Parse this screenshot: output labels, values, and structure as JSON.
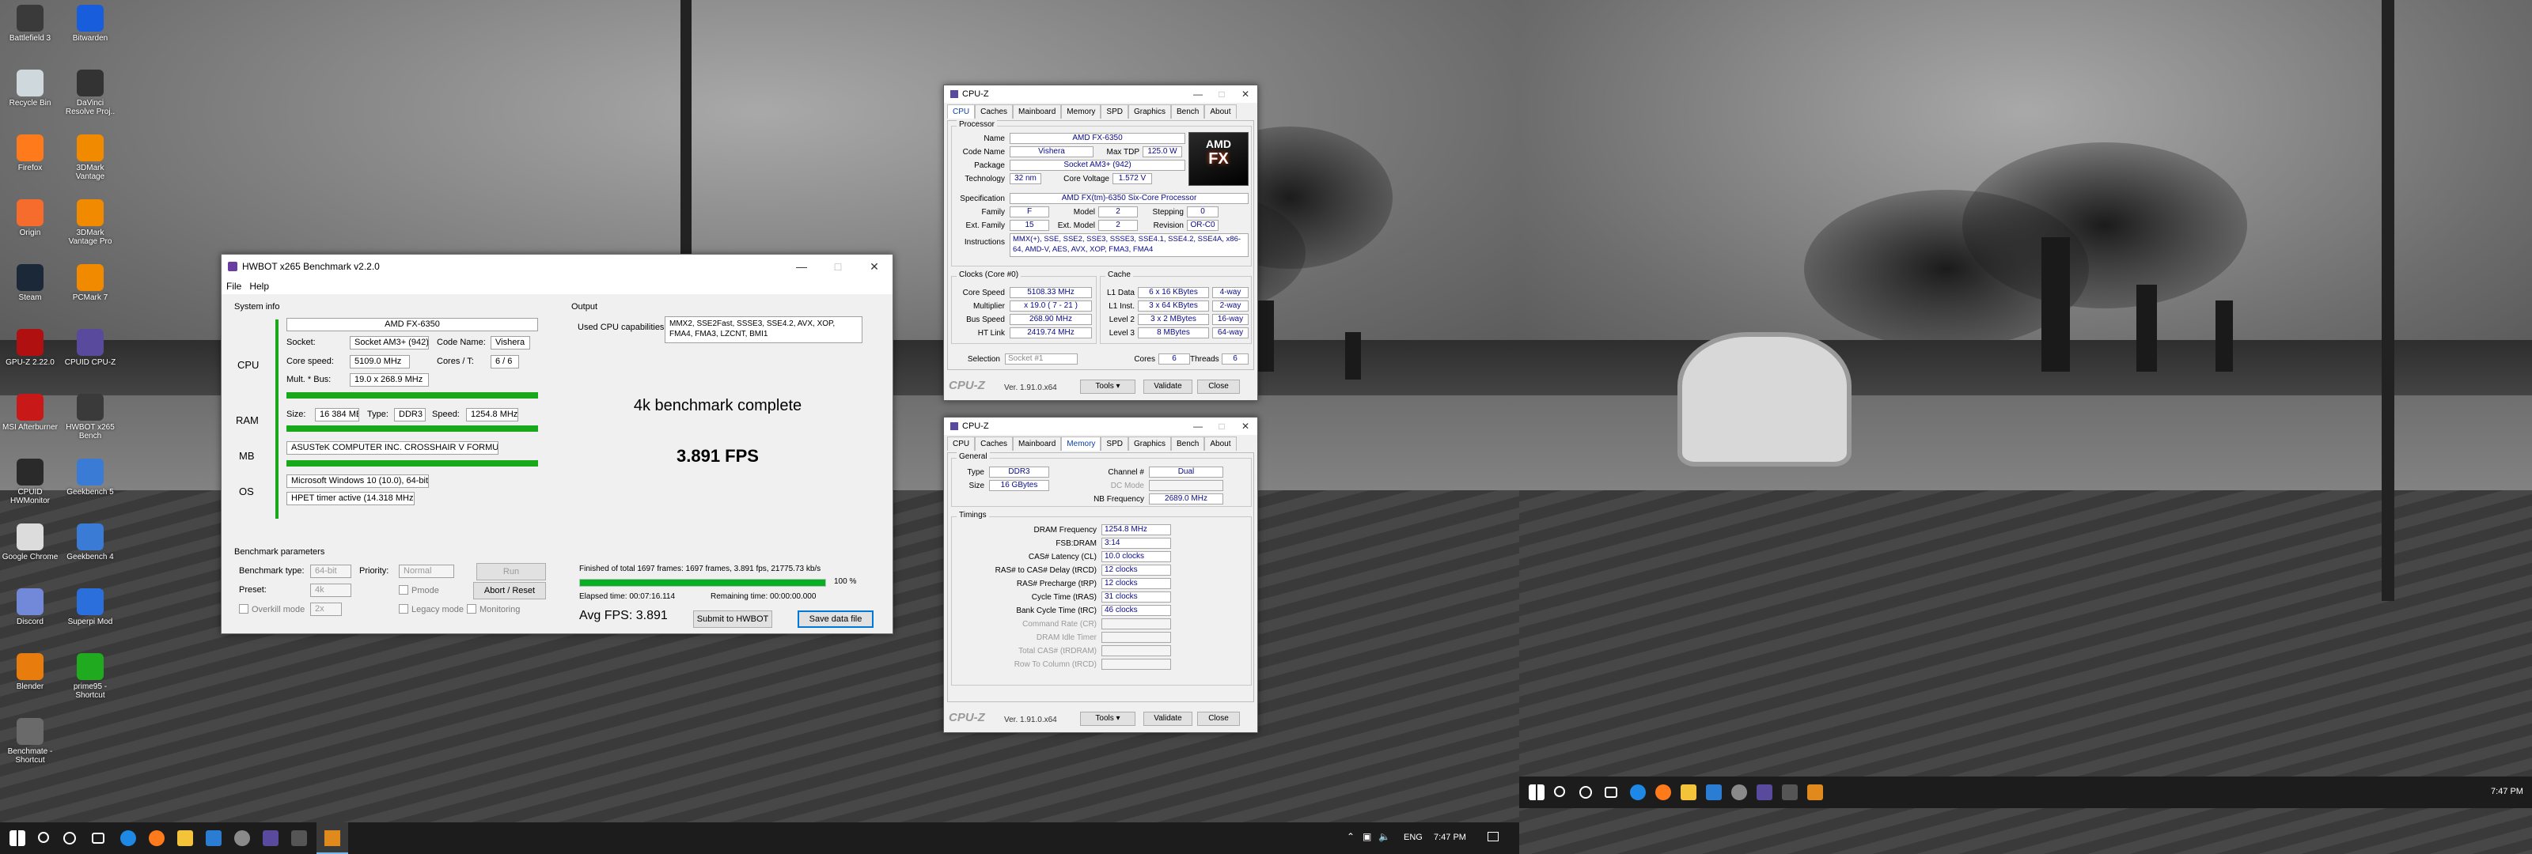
{
  "desktop_icons": [
    {
      "label": "Battlefield 3",
      "color": "#3a3a3a"
    },
    {
      "label": "Recycle Bin",
      "color": "#cfd8dc"
    },
    {
      "label": "Firefox",
      "color": "#ff7a1a"
    },
    {
      "label": "Origin",
      "color": "#f56c2d"
    },
    {
      "label": "Steam",
      "color": "#1b2838"
    },
    {
      "label": "GPU-Z 2.22.0",
      "color": "#b01010"
    },
    {
      "label": "MSI Afterburner",
      "color": "#c81818"
    },
    {
      "label": "CPUID HWMonitor",
      "color": "#2a2a2a"
    },
    {
      "label": "Google Chrome",
      "color": "#dcdcdc"
    },
    {
      "label": "Discord",
      "color": "#7289da"
    },
    {
      "label": "Blender",
      "color": "#e87d0d"
    },
    {
      "label": "Benchmate - Shortcut",
      "color": "#6a6a6a"
    }
  ],
  "desktop_icons_col2": [
    {
      "label": "Bitwarden",
      "color": "#175ddc"
    },
    {
      "label": "DaVinci Resolve Proj..",
      "color": "#333333"
    },
    {
      "label": "3DMark Vantage",
      "color": "#f28a00"
    },
    {
      "label": "3DMark Vantage Pro",
      "color": "#f28a00"
    },
    {
      "label": "PCMark 7",
      "color": "#f28a00"
    },
    {
      "label": "CPUID CPU-Z",
      "color": "#5a4a9e"
    },
    {
      "label": "HWBOT x265 Bench",
      "color": "#3a3a3a"
    },
    {
      "label": "Geekbench 5",
      "color": "#3a7bd5"
    },
    {
      "label": "Geekbench 4",
      "color": "#3a7bd5"
    },
    {
      "label": "Superpi Mod",
      "color": "#2a6fdb"
    },
    {
      "label": "prime95 - Shortcut",
      "color": "#1faa1f"
    }
  ],
  "x265": {
    "title": "HWBOT x265 Benchmark v2.2.0",
    "menu": [
      "File",
      "Help"
    ],
    "system_info_title": "System info",
    "cpu_name": "AMD FX-6350",
    "socket_label": "Socket:",
    "socket": "Socket AM3+ (942)",
    "codename_label": "Code Name:",
    "codename": "Vishera",
    "core_speed_label": "Core speed:",
    "core_speed": "5109.0 MHz",
    "cores_label": "Cores / T:",
    "cores": "6 / 6",
    "mult_label": "Mult. * Bus:",
    "mult": "19.0 x 268.9 MHz",
    "cpu_side": "CPU",
    "ram_side": "RAM",
    "mb_side": "MB",
    "os_side": "OS",
    "size_label": "Size:",
    "size": "16 384 MB",
    "type_label": "Type:",
    "type": "DDR3",
    "speed_label": "Speed:",
    "speed": "1254.8 MHz",
    "mb": "ASUSTeK COMPUTER INC. CROSSHAIR V FORMULA-Z",
    "os": "Microsoft Windows 10 (10.0), 64-bit",
    "timer": "HPET timer active (14.318 MHz )",
    "output_title": "Output",
    "used_caps_label": "Used CPU capabilities:",
    "used_caps": "MMX2, SSE2Fast, SSSE3, SSE4.2, AVX, XOP, FMA4, FMA3, LZCNT, BMI1",
    "complete": "4k benchmark complete",
    "fps": "3.891 FPS",
    "finished": "Finished of total 1697 frames: 1697 frames, 3.891 fps,  21775.73 kb/s",
    "progress": 1.0,
    "progress_text": "100 %",
    "elapsed": "Elapsed time: 00:07:16.114",
    "remaining": "Remaining time: 00:00:00.000",
    "avg": "Avg FPS: 3.891",
    "submit": "Submit to HWBOT",
    "save": "Save data file",
    "params_title": "Benchmark parameters",
    "bench_type_label": "Benchmark type:",
    "bench_type": "64-bit",
    "priority_label": "Priority:",
    "priority": "Normal",
    "run": "Run",
    "preset_label": "Preset:",
    "preset": "4k",
    "pmode": "Pmode",
    "abort": "Abort / Reset",
    "overkill": "Overkill mode",
    "overkill_val": "2x",
    "legacy": "Legacy mode",
    "monitoring": "Monitoring"
  },
  "cpuz1": {
    "title": "CPU-Z",
    "tabs": [
      "CPU",
      "Caches",
      "Mainboard",
      "Memory",
      "SPD",
      "Graphics",
      "Bench",
      "About"
    ],
    "proc_title": "Processor",
    "name_l": "Name",
    "name": "AMD FX-6350",
    "code_l": "Code Name",
    "code": "Vishera",
    "tdp_l": "Max TDP",
    "tdp": "125.0 W",
    "pkg_l": "Package",
    "pkg": "Socket AM3+ (942)",
    "tech_l": "Technology",
    "tech": "32 nm",
    "cv_l": "Core Voltage",
    "cv": "1.572 V",
    "spec_l": "Specification",
    "spec": "AMD FX(tm)-6350 Six-Core Processor",
    "fam_l": "Family",
    "fam": "F",
    "model_l": "Model",
    "model": "2",
    "step_l": "Stepping",
    "step": "0",
    "efam_l": "Ext. Family",
    "efam": "15",
    "emodel_l": "Ext. Model",
    "emodel": "2",
    "rev_l": "Revision",
    "rev": "OR-C0",
    "inst_l": "Instructions",
    "inst": "MMX(+), SSE, SSE2, SSE3, SSSE3, SSE4.1, SSE4.2, SSE4A, x86-64, AMD-V, AES, AVX, XOP, FMA3, FMA4",
    "clocks_title": "Clocks (Core #0)",
    "cs_l": "Core Speed",
    "cs": "5108.33 MHz",
    "mul_l": "Multiplier",
    "mul": "x 19.0 ( 7 - 21 )",
    "bus_l": "Bus Speed",
    "bus": "268.90 MHz",
    "ht_l": "HT Link",
    "ht": "2419.74 MHz",
    "cache_title": "Cache",
    "l1d_l": "L1 Data",
    "l1d": "6 x 16 KBytes",
    "l1d_w": "4-way",
    "l1i_l": "L1 Inst.",
    "l1i": "3 x 64 KBytes",
    "l1i_w": "2-way",
    "l2_l": "Level 2",
    "l2": "3 x 2 MBytes",
    "l2_w": "16-way",
    "l3_l": "Level 3",
    "l3": "8 MBytes",
    "l3_w": "64-way",
    "sel_l": "Selection",
    "sel": "Socket #1",
    "cores_l": "Cores",
    "cores": "6",
    "threads_l": "Threads",
    "threads": "6",
    "logo": "CPU-Z",
    "ver": "Ver. 1.91.0.x64",
    "tools": "Tools",
    "validate": "Validate",
    "close": "Close",
    "amd_logo": "AMD",
    "fx_logo": "FX"
  },
  "cpuz2": {
    "title": "CPU-Z",
    "tabs": [
      "CPU",
      "Caches",
      "Mainboard",
      "Memory",
      "SPD",
      "Graphics",
      "Bench",
      "About"
    ],
    "gen_title": "General",
    "type_l": "Type",
    "type": "DDR3",
    "chan_l": "Channel #",
    "chan": "Dual",
    "size_l": "Size",
    "size": "16 GBytes",
    "dc_l": "DC Mode",
    "nb_l": "NB Frequency",
    "nb": "2689.0 MHz",
    "tim_title": "Timings",
    "rows": [
      {
        "l": "DRAM Frequency",
        "v": "1254.8 MHz"
      },
      {
        "l": "FSB:DRAM",
        "v": "3:14"
      },
      {
        "l": "CAS# Latency (CL)",
        "v": "10.0 clocks"
      },
      {
        "l": "RAS# to CAS# Delay (tRCD)",
        "v": "12 clocks"
      },
      {
        "l": "RAS# Precharge (tRP)",
        "v": "12 clocks"
      },
      {
        "l": "Cycle Time (tRAS)",
        "v": "31 clocks"
      },
      {
        "l": "Bank Cycle Time (tRC)",
        "v": "46 clocks"
      },
      {
        "l": "Command Rate (CR)",
        "v": ""
      },
      {
        "l": "DRAM Idle Timer",
        "v": ""
      },
      {
        "l": "Total CAS# (tRDRAM)",
        "v": ""
      },
      {
        "l": "Row To Column (tRCD)",
        "v": ""
      }
    ],
    "logo": "CPU-Z",
    "ver": "Ver. 1.91.0.x64",
    "tools": "Tools",
    "validate": "Validate",
    "close": "Close"
  },
  "taskbar": {
    "lang": "ENG",
    "time": "7:47 PM"
  },
  "taskbar2": {
    "time": "7:47 PM"
  }
}
